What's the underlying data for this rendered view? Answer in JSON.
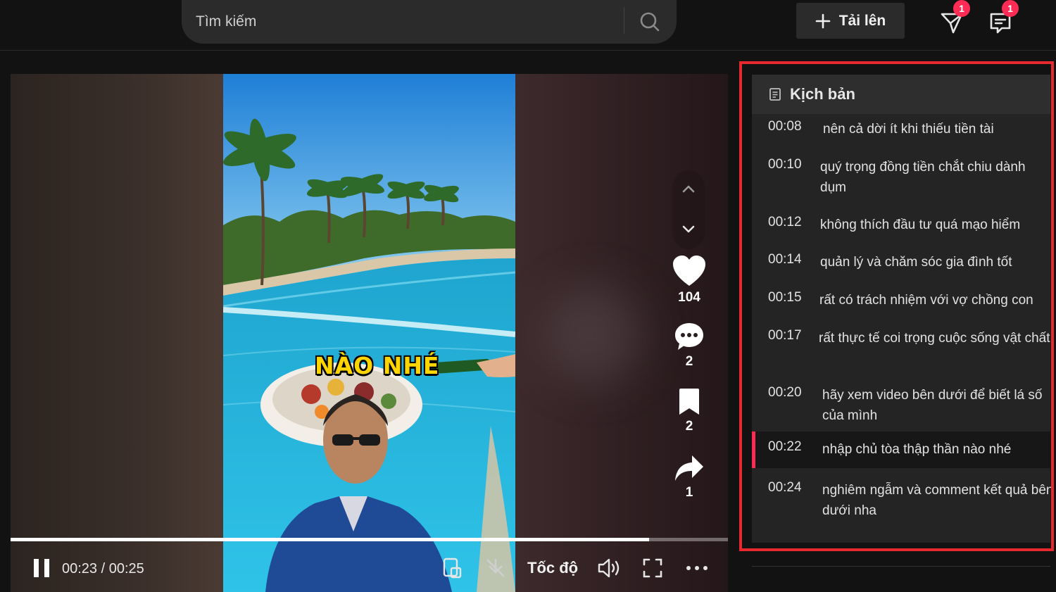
{
  "search": {
    "placeholder": "Tìm kiếm"
  },
  "header": {
    "upload_label": "Tải lên",
    "inbox_badge": "1",
    "messages_badge": "1"
  },
  "video": {
    "caption_overlay": "NÀO NHÉ",
    "likes": "104",
    "comments": "2",
    "saves": "2",
    "shares": "1",
    "current_time": "00:23",
    "duration": "00:25",
    "time_display": "00:23 / 00:25",
    "progress_fraction": 0.89,
    "speed_label": "Tốc độ"
  },
  "transcript": {
    "title": "Kịch bản",
    "lines": [
      {
        "time": "00:08",
        "text": "nên cả dời ít khi thiếu tiền tài"
      },
      {
        "time": "00:10",
        "text": "quý trọng đồng tiền chắt chiu dành dụm"
      },
      {
        "time": "00:12",
        "text": "không thích đầu tư quá mạo hiểm"
      },
      {
        "time": "00:14",
        "text": "quản lý và chăm sóc gia đình tốt"
      },
      {
        "time": "00:15",
        "text": "rất có trách nhiệm với vợ chồng con"
      },
      {
        "time": "00:17",
        "text": "rất thực tế coi trọng cuộc sống vật chất"
      },
      {
        "time": "00:20",
        "text": "hãy xem video bên dưới để biết lá số của mình"
      },
      {
        "time": "00:22",
        "text": "nhập chủ tòa thập thần nào nhé"
      },
      {
        "time": "00:24",
        "text": "nghiêm ngẫm và comment kết quả bên dưới nha"
      }
    ]
  },
  "colors": {
    "accent": "#fe2c55",
    "highlight_outline": "#e8282f"
  }
}
